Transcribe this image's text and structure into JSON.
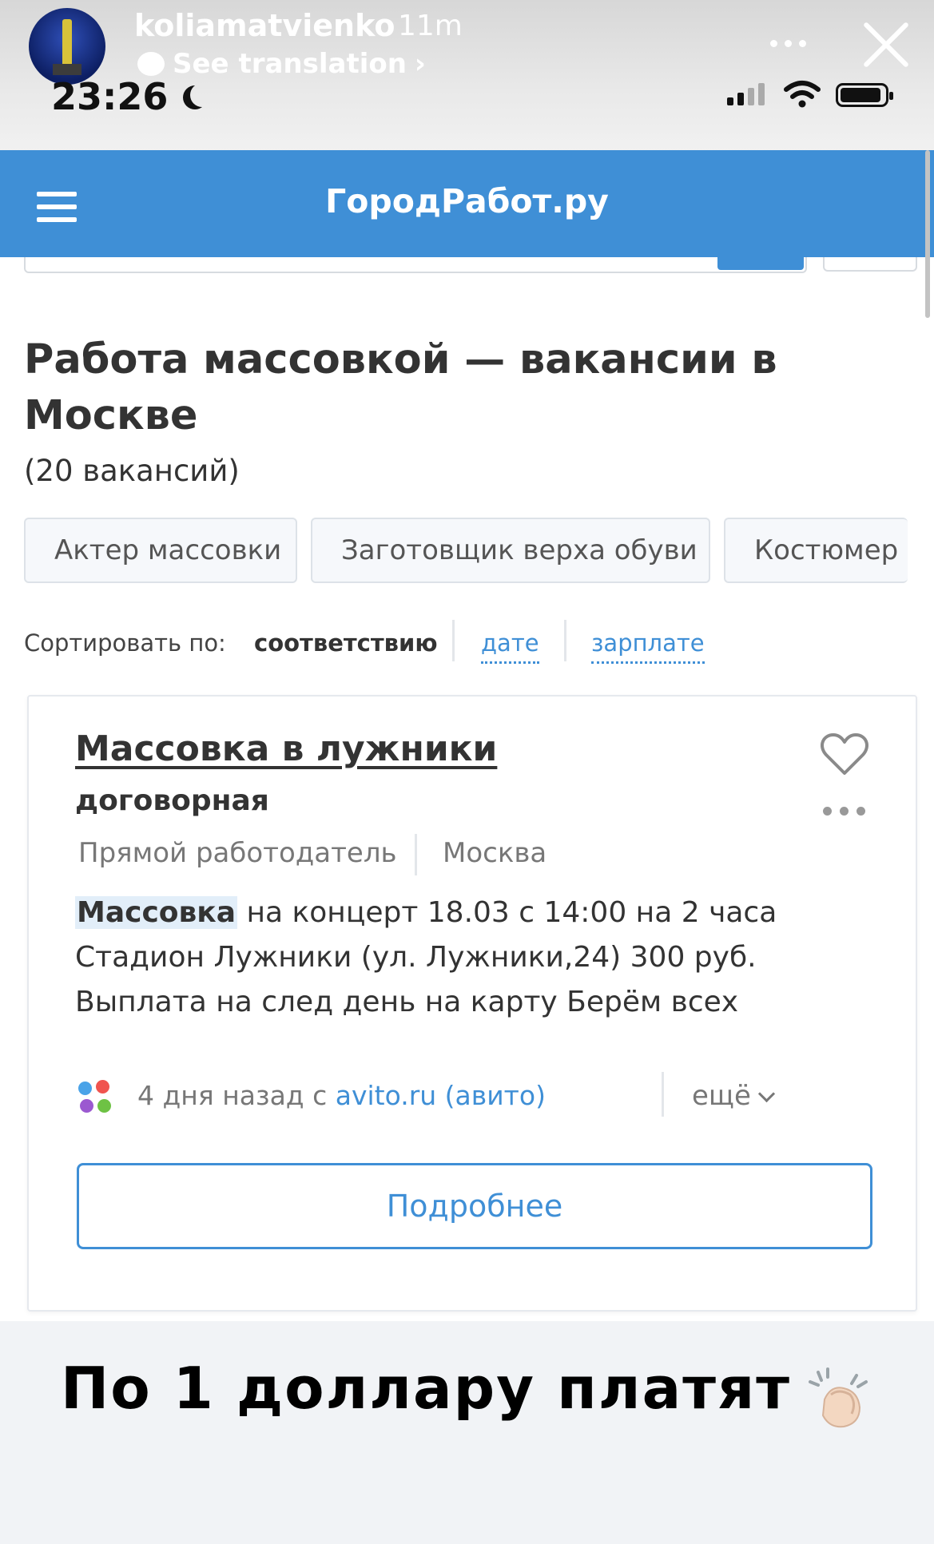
{
  "story": {
    "username": "koliamatvienko",
    "posted_ago": "11m",
    "see_translation": "See translation",
    "clock": "23:26"
  },
  "site": {
    "brand": "ГородРабот.ру",
    "page_title": "Работа массовкой — вакансии в Москве",
    "vacancy_count": "(20 вакансий)",
    "chips": [
      "Актер массовки",
      "Заготовщик верха обуви",
      "Костюмер"
    ],
    "sort": {
      "label": "Сортировать по:",
      "options": [
        "соответствию",
        "дате",
        "зарплате"
      ],
      "active": "соответствию"
    },
    "card": {
      "title": "Массовка в лужники",
      "salary": "договорная",
      "employer_type": "Прямой работодатель",
      "city": "Москва",
      "desc_highlight": "Массовка",
      "desc_line1_rest": " на концерт 18.03 с 14:00 на 2 часа",
      "desc_line2": "Стадион Лужники (ул. Лужники,24) 300 руб.",
      "desc_line3": "Выплата на след день на карту Берём всех",
      "posted": "4 дня назад с ",
      "source": "avito.ru (авито)",
      "more_label": "ещё",
      "details_button": "Подробнее"
    }
  },
  "caption": "По 1 доллару платят",
  "colors": {
    "brand_blue": "#3f8fd6",
    "text_dark": "#333333",
    "text_muted": "#777777"
  }
}
